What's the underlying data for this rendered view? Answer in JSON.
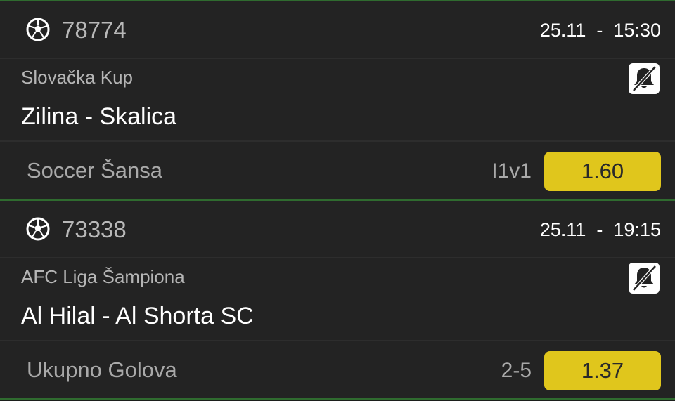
{
  "colors": {
    "accent": "#e0c61c",
    "background": "#232323",
    "divider": "#2f6b2f"
  },
  "events": [
    {
      "icon": "soccer-ball-icon",
      "id": "78774",
      "date": "25.11",
      "separator": "-",
      "time": "15:30",
      "league": "Slovačka Kup",
      "match": "Zilina - Skalica",
      "notification_icon": "bell-off-icon",
      "market": "Soccer Šansa",
      "pick": "I1v1",
      "odds": "1.60"
    },
    {
      "icon": "soccer-ball-icon",
      "id": "73338",
      "date": "25.11",
      "separator": "-",
      "time": "19:15",
      "league": "AFC Liga Šampiona",
      "match": "Al Hilal - Al Shorta SC",
      "notification_icon": "bell-off-icon",
      "market": "Ukupno Golova",
      "pick": "2-5",
      "odds": "1.37"
    }
  ]
}
